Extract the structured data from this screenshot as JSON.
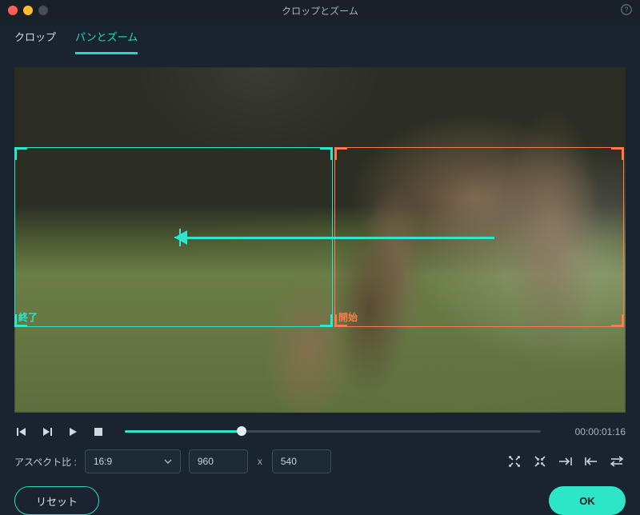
{
  "window": {
    "title": "クロップとズーム"
  },
  "tabs": {
    "crop": "クロップ",
    "panzoom": "パンとズーム"
  },
  "frames": {
    "start_label": "開始",
    "end_label": "終了"
  },
  "playback": {
    "time": "00:00:01:16"
  },
  "aspect": {
    "label": "アスペクト比 :",
    "ratio": "16:9",
    "width": "960",
    "separator": "x",
    "height": "540"
  },
  "buttons": {
    "reset": "リセット",
    "ok": "OK"
  }
}
